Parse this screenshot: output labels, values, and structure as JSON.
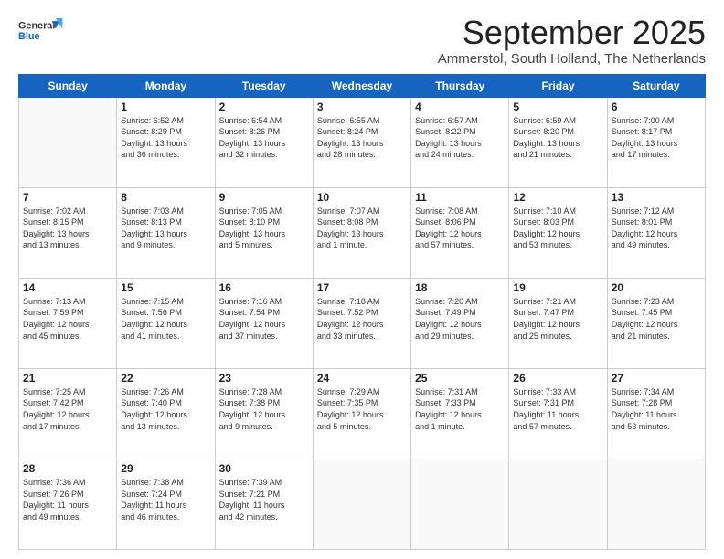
{
  "header": {
    "logo_general": "General",
    "logo_blue": "Blue",
    "month_title": "September 2025",
    "location": "Ammerstol, South Holland, The Netherlands"
  },
  "days_of_week": [
    "Sunday",
    "Monday",
    "Tuesday",
    "Wednesday",
    "Thursday",
    "Friday",
    "Saturday"
  ],
  "weeks": [
    [
      {
        "day": "",
        "info": ""
      },
      {
        "day": "1",
        "info": "Sunrise: 6:52 AM\nSunset: 8:29 PM\nDaylight: 13 hours\nand 36 minutes."
      },
      {
        "day": "2",
        "info": "Sunrise: 6:54 AM\nSunset: 8:26 PM\nDaylight: 13 hours\nand 32 minutes."
      },
      {
        "day": "3",
        "info": "Sunrise: 6:55 AM\nSunset: 8:24 PM\nDaylight: 13 hours\nand 28 minutes."
      },
      {
        "day": "4",
        "info": "Sunrise: 6:57 AM\nSunset: 8:22 PM\nDaylight: 13 hours\nand 24 minutes."
      },
      {
        "day": "5",
        "info": "Sunrise: 6:59 AM\nSunset: 8:20 PM\nDaylight: 13 hours\nand 21 minutes."
      },
      {
        "day": "6",
        "info": "Sunrise: 7:00 AM\nSunset: 8:17 PM\nDaylight: 13 hours\nand 17 minutes."
      }
    ],
    [
      {
        "day": "7",
        "info": "Sunrise: 7:02 AM\nSunset: 8:15 PM\nDaylight: 13 hours\nand 13 minutes."
      },
      {
        "day": "8",
        "info": "Sunrise: 7:03 AM\nSunset: 8:13 PM\nDaylight: 13 hours\nand 9 minutes."
      },
      {
        "day": "9",
        "info": "Sunrise: 7:05 AM\nSunset: 8:10 PM\nDaylight: 13 hours\nand 5 minutes."
      },
      {
        "day": "10",
        "info": "Sunrise: 7:07 AM\nSunset: 8:08 PM\nDaylight: 13 hours\nand 1 minute."
      },
      {
        "day": "11",
        "info": "Sunrise: 7:08 AM\nSunset: 8:06 PM\nDaylight: 12 hours\nand 57 minutes."
      },
      {
        "day": "12",
        "info": "Sunrise: 7:10 AM\nSunset: 8:03 PM\nDaylight: 12 hours\nand 53 minutes."
      },
      {
        "day": "13",
        "info": "Sunrise: 7:12 AM\nSunset: 8:01 PM\nDaylight: 12 hours\nand 49 minutes."
      }
    ],
    [
      {
        "day": "14",
        "info": "Sunrise: 7:13 AM\nSunset: 7:59 PM\nDaylight: 12 hours\nand 45 minutes."
      },
      {
        "day": "15",
        "info": "Sunrise: 7:15 AM\nSunset: 7:56 PM\nDaylight: 12 hours\nand 41 minutes."
      },
      {
        "day": "16",
        "info": "Sunrise: 7:16 AM\nSunset: 7:54 PM\nDaylight: 12 hours\nand 37 minutes."
      },
      {
        "day": "17",
        "info": "Sunrise: 7:18 AM\nSunset: 7:52 PM\nDaylight: 12 hours\nand 33 minutes."
      },
      {
        "day": "18",
        "info": "Sunrise: 7:20 AM\nSunset: 7:49 PM\nDaylight: 12 hours\nand 29 minutes."
      },
      {
        "day": "19",
        "info": "Sunrise: 7:21 AM\nSunset: 7:47 PM\nDaylight: 12 hours\nand 25 minutes."
      },
      {
        "day": "20",
        "info": "Sunrise: 7:23 AM\nSunset: 7:45 PM\nDaylight: 12 hours\nand 21 minutes."
      }
    ],
    [
      {
        "day": "21",
        "info": "Sunrise: 7:25 AM\nSunset: 7:42 PM\nDaylight: 12 hours\nand 17 minutes."
      },
      {
        "day": "22",
        "info": "Sunrise: 7:26 AM\nSunset: 7:40 PM\nDaylight: 12 hours\nand 13 minutes."
      },
      {
        "day": "23",
        "info": "Sunrise: 7:28 AM\nSunset: 7:38 PM\nDaylight: 12 hours\nand 9 minutes."
      },
      {
        "day": "24",
        "info": "Sunrise: 7:29 AM\nSunset: 7:35 PM\nDaylight: 12 hours\nand 5 minutes."
      },
      {
        "day": "25",
        "info": "Sunrise: 7:31 AM\nSunset: 7:33 PM\nDaylight: 12 hours\nand 1 minute."
      },
      {
        "day": "26",
        "info": "Sunrise: 7:33 AM\nSunset: 7:31 PM\nDaylight: 11 hours\nand 57 minutes."
      },
      {
        "day": "27",
        "info": "Sunrise: 7:34 AM\nSunset: 7:28 PM\nDaylight: 11 hours\nand 53 minutes."
      }
    ],
    [
      {
        "day": "28",
        "info": "Sunrise: 7:36 AM\nSunset: 7:26 PM\nDaylight: 11 hours\nand 49 minutes."
      },
      {
        "day": "29",
        "info": "Sunrise: 7:38 AM\nSunset: 7:24 PM\nDaylight: 11 hours\nand 46 minutes."
      },
      {
        "day": "30",
        "info": "Sunrise: 7:39 AM\nSunset: 7:21 PM\nDaylight: 11 hours\nand 42 minutes."
      },
      {
        "day": "",
        "info": ""
      },
      {
        "day": "",
        "info": ""
      },
      {
        "day": "",
        "info": ""
      },
      {
        "day": "",
        "info": ""
      }
    ]
  ]
}
